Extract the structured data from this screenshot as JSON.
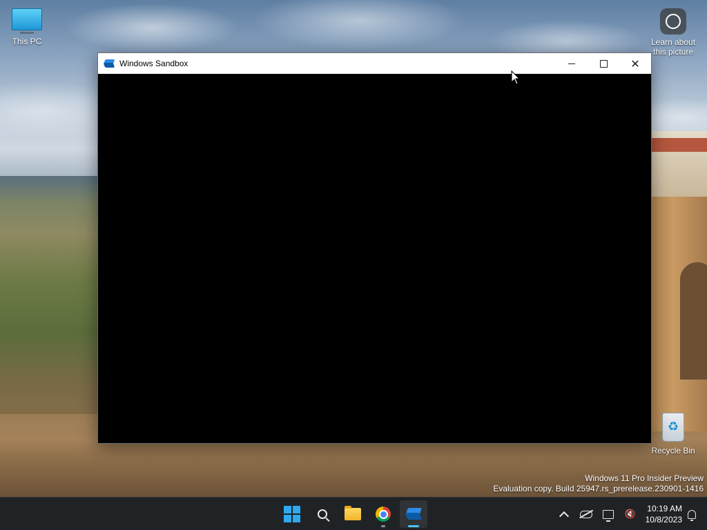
{
  "desktop": {
    "icons": {
      "this_pc": "This PC",
      "learn_about": "Learn about this picture",
      "recycle_bin": "Recycle Bin"
    },
    "watermark": {
      "line1": "Windows 11 Pro Insider Preview",
      "line2": "Evaluation copy. Build 25947.rs_prerelease.230901-1416"
    }
  },
  "window": {
    "title": "Windows Sandbox",
    "icon": "sandbox-icon",
    "controls": [
      "minimize",
      "maximize",
      "close"
    ],
    "content_color": "#000000"
  },
  "taskbar": {
    "apps": [
      {
        "name": "Start",
        "icon": "windows-logo-icon",
        "state": "none"
      },
      {
        "name": "Search",
        "icon": "search-icon",
        "state": "none"
      },
      {
        "name": "File Explorer",
        "icon": "folder-icon",
        "state": "none"
      },
      {
        "name": "Google Chrome",
        "icon": "chrome-icon",
        "state": "open"
      },
      {
        "name": "Windows Sandbox",
        "icon": "sandbox-icon",
        "state": "active"
      }
    ],
    "tray": {
      "time": "10:19 AM",
      "date": "10/8/2023",
      "icons": [
        "chevron-up-icon",
        "onedrive-offline-icon",
        "network-icon",
        "volume-muted-icon",
        "notification-bell-icon"
      ]
    },
    "accent": "#4cc2ff"
  }
}
